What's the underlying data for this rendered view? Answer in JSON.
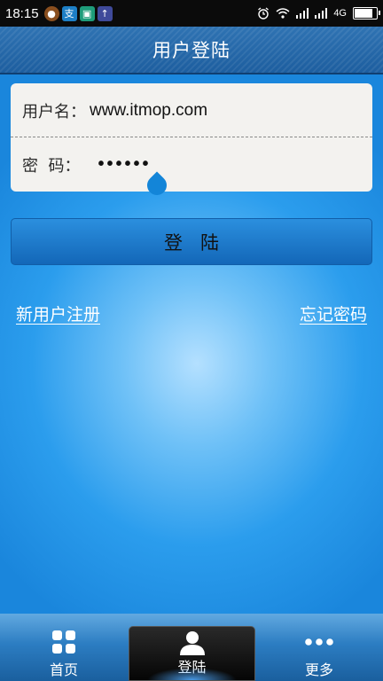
{
  "status_bar": {
    "time": "18:15",
    "network": "4G",
    "battery_level": 0.85
  },
  "header": {
    "title": "用户登陆"
  },
  "form": {
    "username_label": "用户名：",
    "username_value": "www.itmop.com",
    "password_label": "密  码：",
    "password_value": "••••••"
  },
  "login_button": {
    "label": "登陆"
  },
  "links": {
    "register": "新用户注册",
    "forgot_password": "忘记密码"
  },
  "bottom_nav": {
    "items": [
      {
        "label": "首页",
        "icon": "grid-icon"
      },
      {
        "label": "登陆",
        "icon": "user-icon",
        "active": true
      },
      {
        "label": "更多",
        "icon": "more-dots-icon"
      }
    ]
  },
  "colors": {
    "background": "#1f8fe0",
    "title_bar": "#1d5e9f",
    "button": "#1367b8",
    "handle": "#1385d8"
  }
}
